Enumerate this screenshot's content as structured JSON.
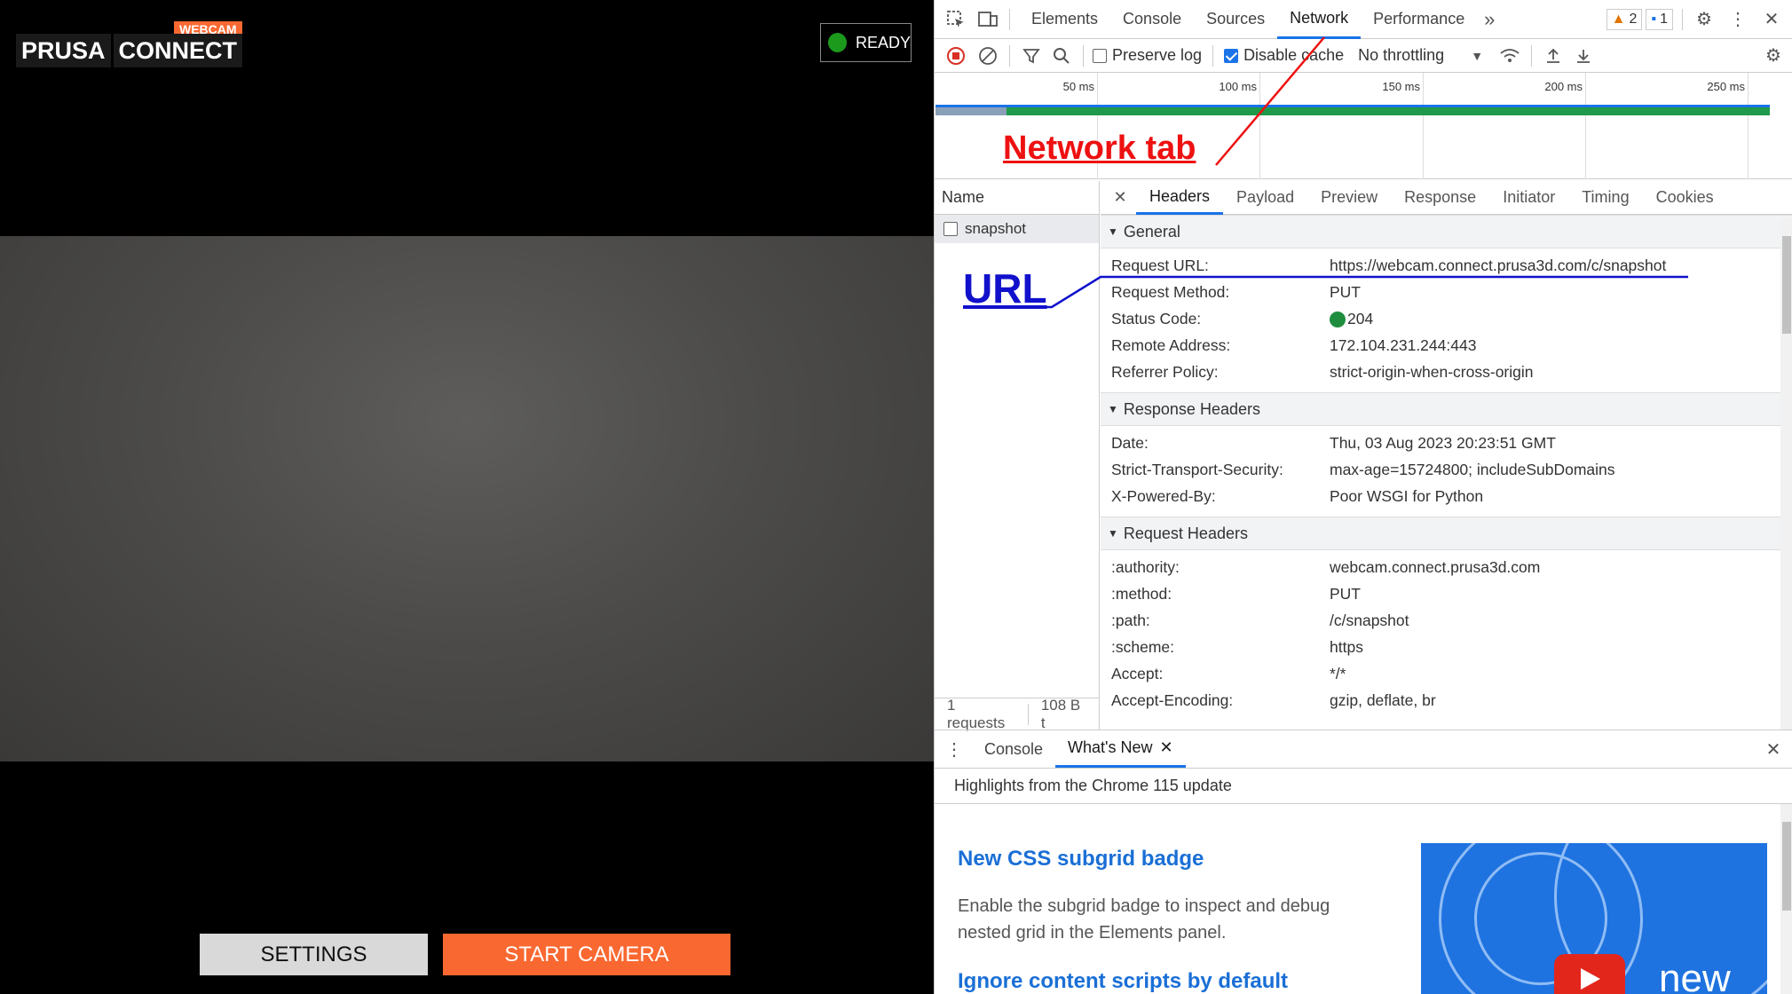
{
  "app": {
    "logo": {
      "badge": "WEBCAM",
      "word1": "PRUSA",
      "word2": "CONNECT"
    },
    "status": {
      "label": "READY",
      "color": "#1c9a1c"
    },
    "buttons": {
      "settings": "SETTINGS",
      "start": "START CAMERA"
    },
    "accent_color": "#fa6831"
  },
  "devtools": {
    "tabs": [
      "Elements",
      "Console",
      "Sources",
      "Network",
      "Performance"
    ],
    "active_tab": "Network",
    "more_tabs_icon": "chevron-double-right-icon",
    "warnings_count": "2",
    "messages_count": "1",
    "toolbar": {
      "preserve_log": "Preserve log",
      "preserve_log_checked": false,
      "disable_cache": "Disable cache",
      "disable_cache_checked": true,
      "throttling": "No throttling"
    },
    "timeline_ticks": [
      "50 ms",
      "100 ms",
      "150 ms",
      "200 ms",
      "250 ms"
    ],
    "requests": {
      "header": "Name",
      "items": [
        "snapshot"
      ],
      "footer_count": "1 requests",
      "footer_size": "108 B t"
    },
    "detail_tabs": [
      "Headers",
      "Payload",
      "Preview",
      "Response",
      "Initiator",
      "Timing",
      "Cookies"
    ],
    "active_detail_tab": "Headers",
    "sections": {
      "general": {
        "title": "General",
        "rows": [
          {
            "k": "Request URL:",
            "v": "https://webcam.connect.prusa3d.com/c/snapshot"
          },
          {
            "k": "Request Method:",
            "v": "PUT"
          },
          {
            "k": "Status Code:",
            "v": "204"
          },
          {
            "k": "Remote Address:",
            "v": "172.104.231.244:443"
          },
          {
            "k": "Referrer Policy:",
            "v": "strict-origin-when-cross-origin"
          }
        ]
      },
      "response": {
        "title": "Response Headers",
        "rows": [
          {
            "k": "Date:",
            "v": "Thu, 03 Aug 2023 20:23:51 GMT"
          },
          {
            "k": "Strict-Transport-Security:",
            "v": "max-age=15724800; includeSubDomains"
          },
          {
            "k": "X-Powered-By:",
            "v": "Poor WSGI for Python"
          }
        ]
      },
      "request": {
        "title": "Request Headers",
        "rows": [
          {
            "k": ":authority:",
            "v": "webcam.connect.prusa3d.com"
          },
          {
            "k": ":method:",
            "v": "PUT"
          },
          {
            "k": ":path:",
            "v": "/c/snapshot"
          },
          {
            "k": ":scheme:",
            "v": "https"
          },
          {
            "k": "Accept:",
            "v": "*/*"
          },
          {
            "k": "Accept-Encoding:",
            "v": "gzip, deflate, br"
          }
        ]
      }
    },
    "drawer": {
      "tabs": [
        "Console",
        "What's New"
      ],
      "active_tab": "What's New",
      "subtitle": "Highlights from the Chrome 115 update",
      "items": [
        {
          "title": "New CSS subgrid badge",
          "desc": "Enable the subgrid badge to inspect and debug nested grid in the Elements panel."
        },
        {
          "title": "Ignore content scripts by default"
        }
      ],
      "image_text": "new"
    }
  },
  "annotations": {
    "network_tab": "Network tab",
    "url": "URL",
    "network_color": "#ee1111",
    "url_color": "#1111cc"
  }
}
